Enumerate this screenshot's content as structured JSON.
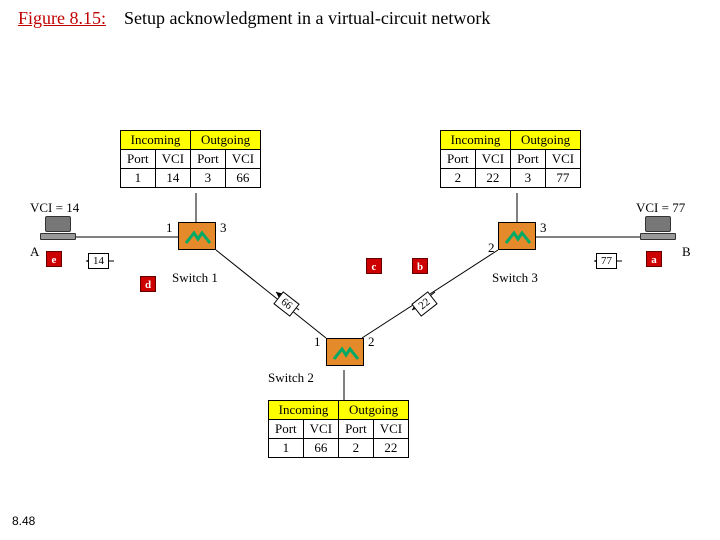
{
  "figure": {
    "label": "Figure 8.15:",
    "caption": "Setup acknowledgment in a virtual-circuit network"
  },
  "pagenum": "8.48",
  "hosts": {
    "A": {
      "name": "A",
      "vci_label": "VCI = 14"
    },
    "B": {
      "name": "B",
      "vci_label": "VCI = 77"
    }
  },
  "switches": {
    "s1": {
      "label": "Switch 1",
      "ports": {
        "left": "1",
        "right": "3"
      }
    },
    "s2": {
      "label": "Switch 2",
      "ports": {
        "left": "1",
        "right": "2"
      }
    },
    "s3": {
      "label": "Switch 3",
      "ports": {
        "left": "2",
        "right": "3"
      }
    }
  },
  "tables": {
    "headers": {
      "in": "Incoming",
      "out": "Outgoing",
      "port": "Port",
      "vci": "VCI"
    },
    "s1": {
      "in_port": "1",
      "in_vci": "14",
      "out_port": "3",
      "out_vci": "66"
    },
    "s2": {
      "in_port": "1",
      "in_vci": "66",
      "out_port": "2",
      "out_vci": "22"
    },
    "s3": {
      "in_port": "2",
      "in_vci": "22",
      "out_port": "3",
      "out_vci": "77"
    }
  },
  "packets": {
    "e": {
      "tag": "e",
      "vci": "14"
    },
    "d": {
      "tag": "d"
    },
    "c": {
      "tag": "c",
      "vci": "66"
    },
    "b": {
      "tag": "b",
      "vci": "22"
    },
    "a": {
      "tag": "a",
      "vci": "77"
    }
  }
}
